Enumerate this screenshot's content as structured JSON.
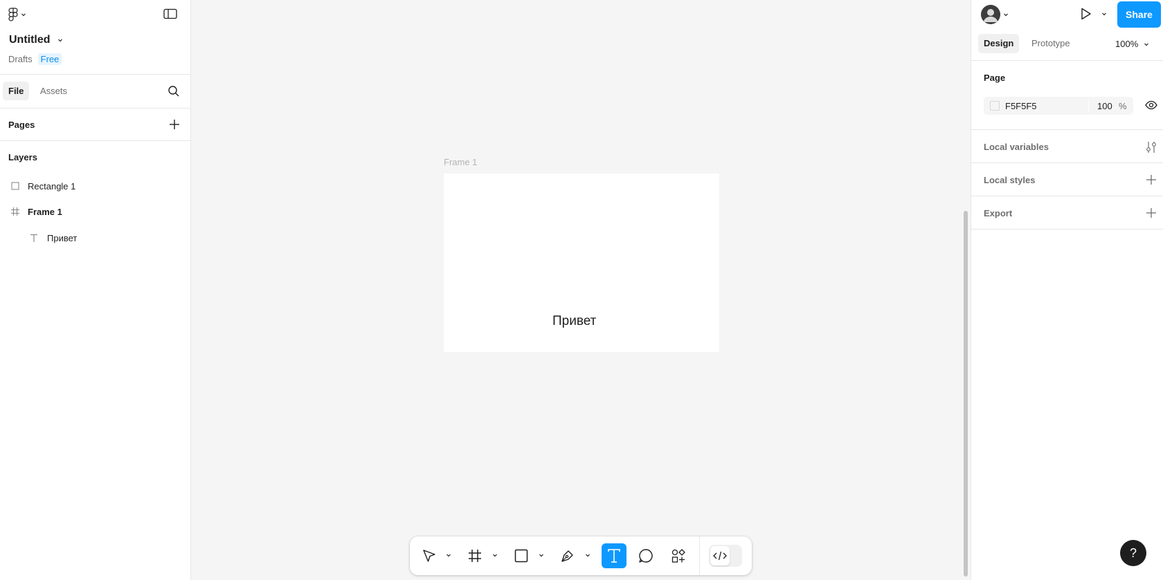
{
  "file": {
    "title": "Untitled",
    "location": "Drafts",
    "plan": "Free"
  },
  "left_tabs": [
    {
      "label": "File",
      "active": true
    },
    {
      "label": "Assets",
      "active": false
    }
  ],
  "pages_label": "Pages",
  "layers_label": "Layers",
  "layers": [
    {
      "name": "Rectangle 1",
      "icon": "rectangle-icon"
    },
    {
      "name": "Frame 1",
      "icon": "frame-icon"
    },
    {
      "name": "Привет",
      "icon": "text-icon"
    }
  ],
  "canvas": {
    "frame_label": "Frame 1",
    "frame_text": "Привет"
  },
  "right": {
    "share_label": "Share",
    "tabs": [
      {
        "label": "Design",
        "active": true
      },
      {
        "label": "Prototype",
        "active": false
      }
    ],
    "zoom": "100%",
    "page_section": "Page",
    "page_color": "F5F5F5",
    "page_opacity": "100",
    "opacity_unit": "%",
    "local_variables": "Local variables",
    "local_styles": "Local styles",
    "export": "Export"
  },
  "toolbar": {
    "tools": [
      "move-tool",
      "frame-tool",
      "shape-tool",
      "pen-tool",
      "text-tool",
      "comment-tool",
      "actions-tool"
    ],
    "active_tool": "text-tool",
    "accent": "#0d99ff"
  },
  "help_label": "?"
}
